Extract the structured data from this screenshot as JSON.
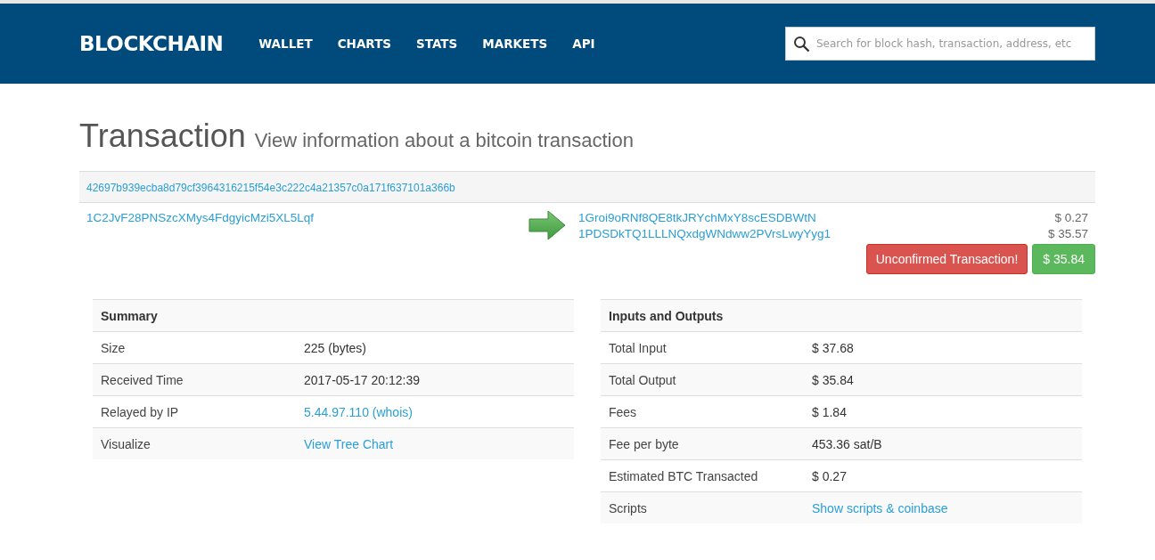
{
  "header": {
    "logo": "BLOCKCHAIN",
    "nav": [
      {
        "label": "WALLET"
      },
      {
        "label": "CHARTS"
      },
      {
        "label": "STATS"
      },
      {
        "label": "MARKETS"
      },
      {
        "label": "API"
      }
    ],
    "search": {
      "placeholder": "Search for block hash, transaction, address, etc"
    }
  },
  "page": {
    "title": "Transaction",
    "subtitle": "View information about a bitcoin transaction"
  },
  "transaction": {
    "hash": "42697b939ecba8d79cf3964316215f54e3c222c4a21357c0a171f637101a366b",
    "inputs": [
      "1C2JvF28PNSzcXMys4FdgyicMzi5XL5Lqf"
    ],
    "outputs": [
      {
        "address": "1Groi9oRNf8QE8tkJRYchMxY8scESDBWtN",
        "amount": "$ 0.27"
      },
      {
        "address": "1PDSDkTQ1LLLNQxdgWNdww2PVrsLwyYyg1",
        "amount": "$ 35.57"
      }
    ],
    "status": "Unconfirmed Transaction!",
    "total": "$ 35.84"
  },
  "tables": [
    {
      "title": "Summary",
      "rows": [
        {
          "label": "Size",
          "value": "225 (bytes)",
          "kind": "text"
        },
        {
          "label": "Received Time",
          "value": "2017-05-17 20:12:39",
          "kind": "text"
        },
        {
          "label": "Relayed by IP",
          "value": "5.44.97.110 (whois)",
          "kind": "link"
        },
        {
          "label": "Visualize",
          "value": "View Tree Chart",
          "kind": "link"
        }
      ]
    },
    {
      "title": "Inputs and Outputs",
      "rows": [
        {
          "label": "Total Input",
          "value": "$ 37.68",
          "kind": "text"
        },
        {
          "label": "Total Output",
          "value": "$ 35.84",
          "kind": "text"
        },
        {
          "label": "Fees",
          "value": "$ 1.84",
          "kind": "text"
        },
        {
          "label": "Fee per byte",
          "value": "453.36 sat/B",
          "kind": "text"
        },
        {
          "label": "Estimated BTC Transacted",
          "value": "$ 0.27",
          "kind": "text"
        },
        {
          "label": "Scripts",
          "value": "Show scripts & coinbase",
          "kind": "link"
        }
      ]
    }
  ]
}
